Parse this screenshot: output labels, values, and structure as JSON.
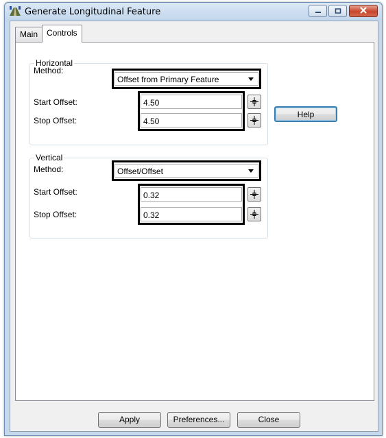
{
  "window": {
    "title": "Generate Longitudinal Feature"
  },
  "tabs": [
    {
      "label": "Main"
    },
    {
      "label": "Controls"
    }
  ],
  "horizontal": {
    "legend": "Horizontal",
    "method_label": "Method:",
    "method_value": "Offset from Primary Feature",
    "start_label": "Start Offset:",
    "start_value": "4.50",
    "stop_label": "Stop Offset:",
    "stop_value": "4.50"
  },
  "vertical": {
    "legend": "Vertical",
    "method_label": "Method:",
    "method_value": "Offset/Offset",
    "start_label": "Start Offset:",
    "start_value": "0.32",
    "stop_label": "Stop Offset:",
    "stop_value": "0.32"
  },
  "buttons": {
    "help": "Help",
    "apply": "Apply",
    "preferences": "Preferences...",
    "close": "Close"
  },
  "icons": {
    "app": "road-feature-icon",
    "pick": "crosshair-pick-icon",
    "minimize": "minimize-icon",
    "maximize": "maximize-icon",
    "close": "close-icon"
  },
  "colors": {
    "highlight_border": "#000000",
    "close_button": "#c7452c",
    "default_button_border": "#3c7fb1"
  }
}
